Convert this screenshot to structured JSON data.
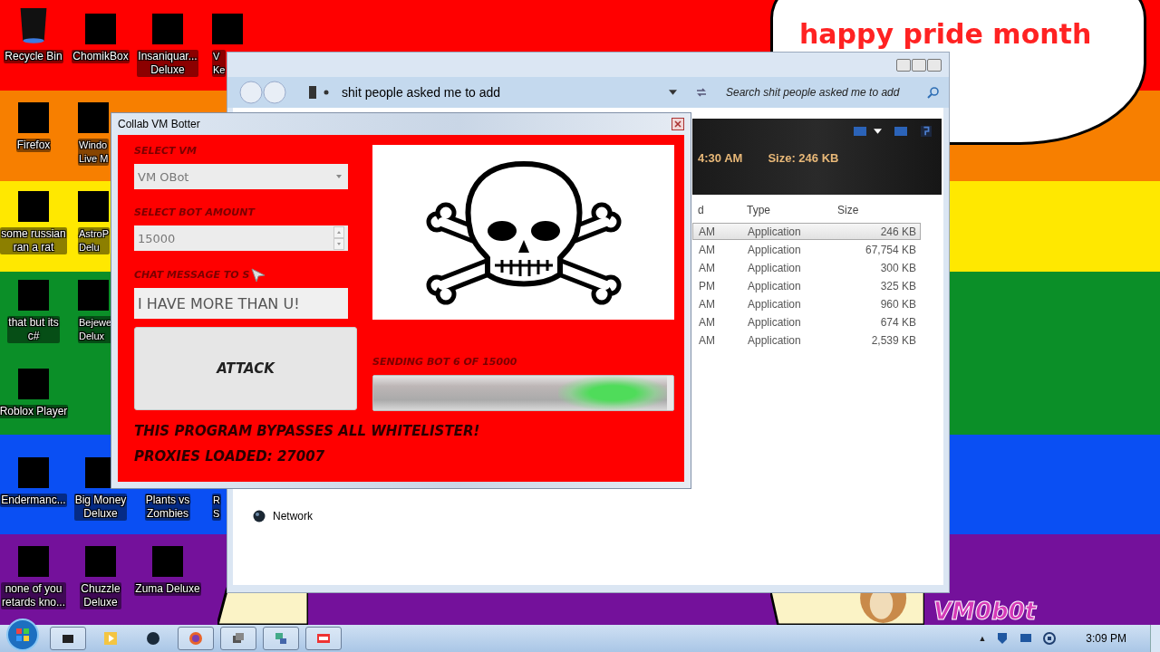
{
  "desktop": {
    "banner": "happy pride month",
    "signature": "VM0b0t",
    "columns": [
      [
        {
          "kind": "bin",
          "label": [
            "Recycle Bin"
          ],
          "cut": false
        },
        {
          "kind": "app",
          "label": [
            "Firefox"
          ],
          "cut": false
        },
        {
          "kind": "app",
          "label": [
            "some russian",
            "ran a rat"
          ],
          "cut": false
        },
        {
          "kind": "app",
          "label": [
            "that but its",
            "c#"
          ],
          "cut": false
        },
        {
          "kind": "app",
          "label": [
            "Roblox Player"
          ],
          "cut": false
        },
        {
          "kind": "app",
          "label": [
            "Endermanc..."
          ],
          "cut": false
        },
        {
          "kind": "app",
          "label": [
            "none of you",
            "retards kno..."
          ],
          "cut": false
        }
      ],
      [
        {
          "kind": "app",
          "label": [
            "ChomikBox"
          ],
          "cut": false
        },
        {
          "kind": "app",
          "label": [
            "Windo",
            "Live M"
          ],
          "cut": true
        },
        {
          "kind": "app",
          "label": [
            "AstroP",
            "Delu"
          ],
          "cut": true
        },
        {
          "kind": "app",
          "label": [
            "Bejewe",
            "Delux"
          ],
          "cut": true
        },
        {
          "kind": "blank"
        },
        {
          "kind": "app",
          "label": [
            "Big Money",
            "Deluxe"
          ],
          "cut": false
        },
        {
          "kind": "app",
          "label": [
            "Chuzzle",
            "Deluxe"
          ],
          "cut": false
        }
      ],
      [
        {
          "kind": "app",
          "label": [
            "Insaniquar...",
            "Deluxe"
          ],
          "cut": false
        },
        {
          "kind": "blank"
        },
        {
          "kind": "blank"
        },
        {
          "kind": "blank"
        },
        {
          "kind": "blank"
        },
        {
          "kind": "label",
          "label": [
            "Plants vs",
            "Zombies"
          ],
          "cut": false
        },
        {
          "kind": "app",
          "label": [
            "Zuma Deluxe"
          ],
          "cut": false
        }
      ],
      [
        {
          "kind": "app",
          "label": [
            "V",
            "Ke"
          ],
          "cut": true
        },
        {
          "kind": "blank"
        },
        {
          "kind": "blank"
        },
        {
          "kind": "blank"
        },
        {
          "kind": "blank"
        },
        {
          "kind": "label",
          "label": [
            "R",
            "S"
          ],
          "cut": true
        }
      ]
    ]
  },
  "explorer": {
    "address": "shit people asked me to add",
    "search": {
      "placeholder": "Search shit people asked me to add"
    },
    "details": [
      "4:30 AM",
      "Size: 246 KB"
    ],
    "columns": [
      "d",
      "Type",
      "Size"
    ],
    "rows": [
      {
        "time": "AM",
        "type": "Application",
        "size": "246 KB",
        "selected": true
      },
      {
        "time": "AM",
        "type": "Application",
        "size": "67,754 KB",
        "selected": false
      },
      {
        "time": "AM",
        "type": "Application",
        "size": "300 KB",
        "selected": false
      },
      {
        "time": "PM",
        "type": "Application",
        "size": "325 KB",
        "selected": false
      },
      {
        "time": "AM",
        "type": "Application",
        "size": "960 KB",
        "selected": false
      },
      {
        "time": "AM",
        "type": "Application",
        "size": "674 KB",
        "selected": false
      },
      {
        "time": "AM",
        "type": "Application",
        "size": "2,539 KB",
        "selected": false
      }
    ],
    "nav": [
      "Network"
    ]
  },
  "dialog": {
    "title": "Collab VM Botter",
    "vm_label": "SELECT VM",
    "vm_value": "VM OBot",
    "amount_label": "SELECT BOT AMOUNT",
    "amount_value": "15000",
    "message_label": "CHAT MESSAGE TO S",
    "message_value": "I HAVE MORE THAN U!",
    "button": "ATTACK",
    "progress_label": "SENDING BOT 6 OF 15000",
    "progress": {
      "level": 0.98
    },
    "notes": [
      "THIS PROGRAM BYPASSES ALL WHITELISTER!",
      "PROXIES LOADED: 27007"
    ]
  },
  "taskbar": {
    "tray_arrow": "▲",
    "clock": "3:09 PM"
  }
}
